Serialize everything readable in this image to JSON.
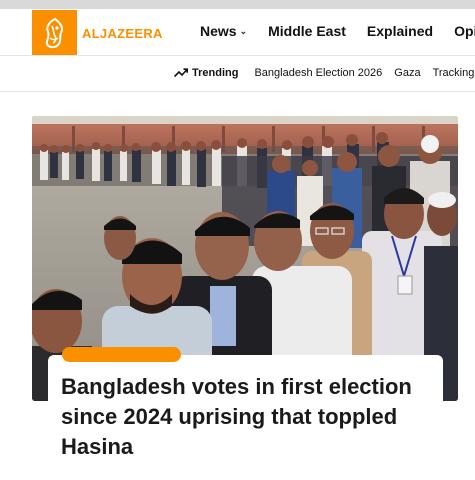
{
  "header": {
    "logo_text": "ALJAZEERA",
    "nav": [
      {
        "label": "News",
        "has_dropdown": true
      },
      {
        "label": "Middle East",
        "has_dropdown": false
      },
      {
        "label": "Explained",
        "has_dropdown": false
      },
      {
        "label": "Opinio",
        "has_dropdown": false
      }
    ]
  },
  "trending": {
    "label": "Trending",
    "links": [
      "Bangladesh Election 2026",
      "Gaza",
      "Tracking Isra"
    ]
  },
  "hero": {
    "headline": "Bangladesh votes in first election since 2024 uprising that toppled Hasina"
  },
  "colors": {
    "brand": "#fa9000",
    "text": "#1a1a1a"
  }
}
